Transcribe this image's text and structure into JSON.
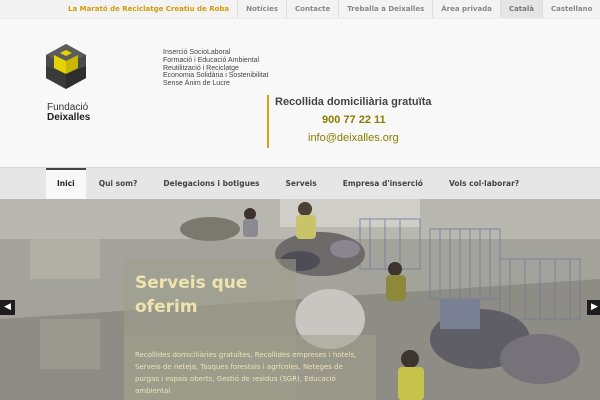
{
  "topbar": {
    "feature_link": "La Marató de Reciclatge Creatiu de Roba",
    "links": [
      "Notícies",
      "Contacte",
      "Treballa a Deixalles",
      "Àrea privada"
    ],
    "languages": [
      "Català",
      "Castellano"
    ],
    "active_language": "Català"
  },
  "header": {
    "logo_line1": "Fundació",
    "logo_line2": "Deixalles",
    "taglines": [
      "Inserció SocioLaboral",
      "Formació i Educació Ambiental",
      "Reutilització i Reciclatge",
      "Economia Solidària i Sostenibilitat",
      "Sense Ànim de Lucre"
    ],
    "contact_title": "Recollida domiciliària gratuïta",
    "contact_phone": "900 77 22 11",
    "contact_email": "info@deixalles.org"
  },
  "nav": {
    "items": [
      "Inici",
      "Qui som?",
      "Delegacions i botigues",
      "Serveis",
      "Empresa d'inserció",
      "Vols col·laborar?"
    ],
    "active": "Inici"
  },
  "slider": {
    "title": "Serveis que oferim",
    "text": "Recollides domiciliàries gratuïtes, Recollides empreses i hotels, Serveis de neteja, Tasques forestals i agrícoles, Neteges de purgas i espais oberts, Gestió de residus (SGR), Educació ambiental"
  },
  "icons": {
    "prev": "arrow-left-icon",
    "next": "arrow-right-icon",
    "logo": "deixalles-logo-icon"
  },
  "colors": {
    "accent": "#d39b07",
    "contact_accent": "#8a7c00",
    "logo_yellow": "#e6d400"
  }
}
